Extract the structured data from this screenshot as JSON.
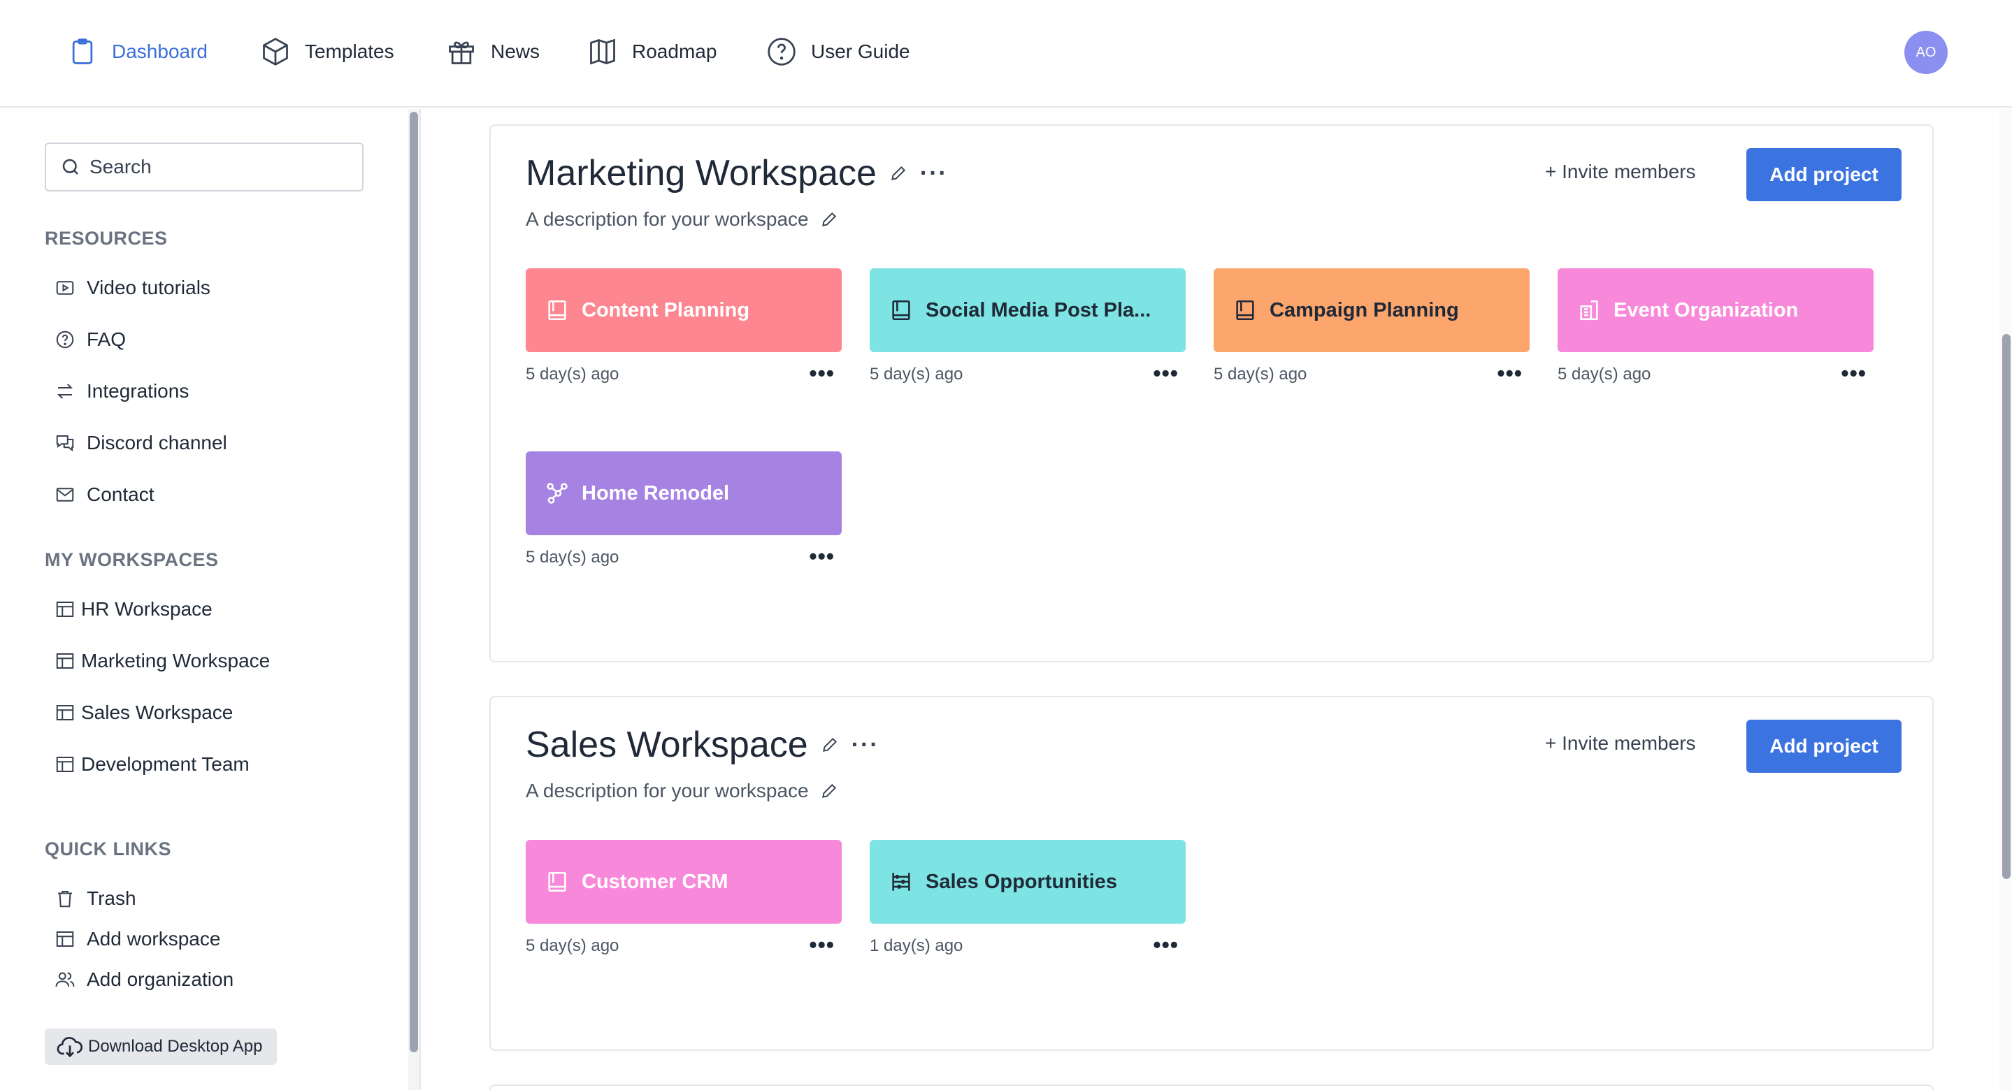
{
  "nav": {
    "items": [
      {
        "label": "Dashboard",
        "icon": "clipboard-icon",
        "active": true
      },
      {
        "label": "Templates",
        "icon": "cube-icon"
      },
      {
        "label": "News",
        "icon": "gift-icon"
      },
      {
        "label": "Roadmap",
        "icon": "map-icon"
      },
      {
        "label": "User Guide",
        "icon": "question-circle-icon"
      }
    ],
    "avatar_initials": "AO"
  },
  "sidebar": {
    "search_placeholder": "Search",
    "resources_title": "RESOURCES",
    "resources": [
      {
        "label": "Video tutorials",
        "icon": "video-icon"
      },
      {
        "label": "FAQ",
        "icon": "question-icon"
      },
      {
        "label": "Integrations",
        "icon": "arrows-exchange-icon"
      },
      {
        "label": "Discord channel",
        "icon": "chat-icon"
      },
      {
        "label": "Contact",
        "icon": "mail-icon"
      }
    ],
    "workspaces_title": "MY WORKSPACES",
    "workspaces": [
      {
        "label": "HR Workspace"
      },
      {
        "label": "Marketing Workspace"
      },
      {
        "label": "Sales Workspace"
      },
      {
        "label": "Development Team"
      }
    ],
    "quick_links_title": "QUICK LINKS",
    "quick_links": [
      {
        "label": "Trash",
        "icon": "trash-icon"
      },
      {
        "label": "Add workspace",
        "icon": "table-icon"
      },
      {
        "label": "Add organization",
        "icon": "users-icon"
      }
    ],
    "download_label": "Download Desktop App"
  },
  "workspaces": [
    {
      "title": "Marketing Workspace",
      "description": "A description for your workspace",
      "invite_label": "+ Invite members",
      "add_project_label": "Add project",
      "projects": [
        {
          "name": "Content Planning",
          "ago": "5 day(s) ago",
          "color": "#fd8690",
          "icon": "book-icon"
        },
        {
          "name": "Social Media Post Pla...",
          "ago": "5 day(s) ago",
          "color": "#7ee3e3",
          "icon": "book-icon",
          "dark": true
        },
        {
          "name": "Campaign Planning",
          "ago": "5 day(s) ago",
          "color": "#fca56c",
          "icon": "book-icon",
          "dark": true
        },
        {
          "name": "Event Organization",
          "ago": "5 day(s) ago",
          "color": "#f889da",
          "icon": "building-icon"
        },
        {
          "name": "Home Remodel",
          "ago": "5 day(s) ago",
          "color": "#a683e3",
          "icon": "graph-icon"
        }
      ]
    },
    {
      "title": "Sales Workspace",
      "description": "A description for your workspace",
      "invite_label": "+ Invite members",
      "add_project_label": "Add project",
      "projects": [
        {
          "name": "Customer CRM",
          "ago": "5 day(s) ago",
          "color": "#f889da",
          "icon": "book-icon"
        },
        {
          "name": "Sales Opportunities",
          "ago": "1 day(s) ago",
          "color": "#7ee3e3",
          "icon": "abacus-icon",
          "dark": true
        }
      ]
    }
  ],
  "colors": {
    "accent": "#3b73e0",
    "active_nav": "#3b6fd8",
    "avatar": "#8b8ff0"
  }
}
